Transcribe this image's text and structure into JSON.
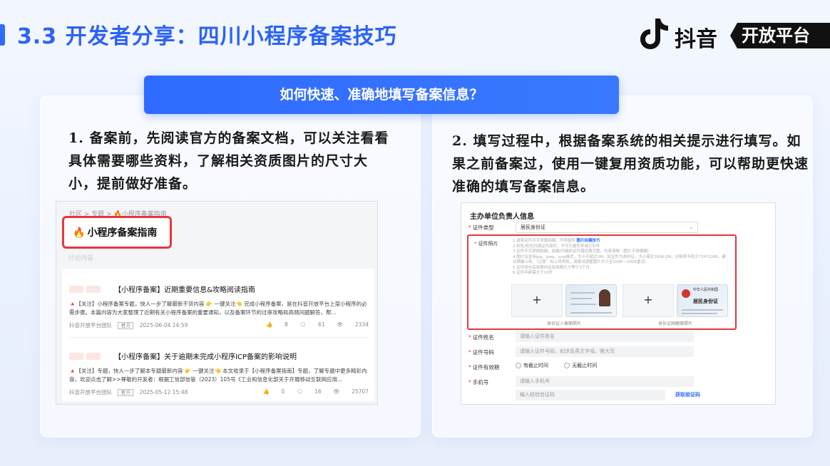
{
  "header": {
    "title": "3.3 开发者分享：四川小程序备案技巧",
    "brand_name": "抖音",
    "brand_tag": "开放平台"
  },
  "banner": {
    "question": "如何快速、准确地填写备案信息？"
  },
  "left": {
    "paragraph": "1. 备案前，先阅读官方的备案文档，可以关注看看具体需要哪些资料，了解相关资质图片的尺寸大小，提前做好准备。",
    "screenshot": {
      "breadcrumb": "社区 > 专题 > 🔥小程序备案指南",
      "guide_title": "小程序备案指南",
      "faint_subtitle": "讨论内容",
      "articles": [
        {
          "title": "【小程序备案】近期重要信息&攻略阅读指南",
          "body": "🔺【关注】小程序备案专题，快人一步了解最新干货内容 👉 一键关注👈 完成小程序备案，是在抖音开放平台上架小程序的必需步骤。本篇内容为大家整理了近期有关小程序备案的重要通知，以及备案环节的过审攻略和高频问题解答，帮...",
          "author": "抖音开放平台团队",
          "badge": "官方",
          "date": "2025-06-04 14:59",
          "likes": "8",
          "comments": "61",
          "views": "2334"
        },
        {
          "title": "【小程序备案】关于逾期未完成小程序ICP备案的影响说明",
          "body": "🔺【关注】专题，快人一步了解本专题最新内容 👉 一键关注👈 本文收录于【小程序备案指南】专题，了解专题中更多精彩内容，欢迎点击了解>>尊敬的开发者：根据工信部信管（2023）105号《工业和信息化部关于开展移动互联网应用...",
          "author": "抖音开放平台团队",
          "badge": "官方",
          "date": "2025-05-12 15:48",
          "likes": "0",
          "comments": "16",
          "views": "25707"
        }
      ]
    }
  },
  "right": {
    "paragraph": "2. 填写过程中，根据备案系统的相关提示进行填写。如果之前备案过，使用一键复用资质功能，可以帮助更快速准确的填写备案信息。",
    "form": {
      "heading": "主办单位负责人信息",
      "id_type_label": "证件类型",
      "id_type_value": "居民身份证",
      "photo_label": "证件照片",
      "photo_tips": [
        "1.请将证件水平放置拍摄，不得旋转",
        "2.彩色/彩色扫描证件原件，不可为复印件或打印件",
        "3.证件不可遮挡拍摄，拍摄/扫描的证件需边角完整，内容清晰（图片不得模糊）",
        "4.图片仅支持jpg、jpeg、png格式，大小不超过2M。如证件为身份证，大小需在100K-2M，分辨率不低于720*1280，建议横摄上传。（注意：如上传失败，请尝试调整图片大小至100K～200K重试）",
        "5.证件须在有效期内且有效期大于等于3个月",
        "6.证件年龄需大于16岁"
      ],
      "photo_tips_link": "图片拍摄技巧",
      "front_caption": "身份证人像面照片",
      "back_caption": "身份证国徽面照片",
      "id_card_country": "中华人民共和国",
      "id_card_title": "居民身份证",
      "name_label": "证件姓名",
      "name_placeholder": "请输入证件姓名",
      "number_label": "证件号码",
      "number_placeholder": "请输入证件号码，如涉及英文字母，需大写",
      "validity_label": "证件有效期",
      "validity_option_1": "有截止时间",
      "validity_option_2": "无截止时间",
      "phone_label": "手机号",
      "phone_placeholder": "请输入手机号",
      "sms_placeholder": "输入短信验证码",
      "sms_button": "获取验证码"
    }
  },
  "colors": {
    "accent": "#2f6bff",
    "highlight_red": "#e8363b"
  }
}
